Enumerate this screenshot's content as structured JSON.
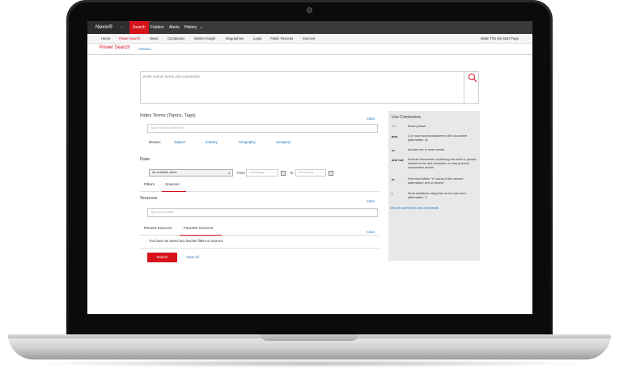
{
  "app": {
    "brand": "Nexis®"
  },
  "top_nav": [
    "Search",
    "Folders",
    "Alerts",
    "History"
  ],
  "sub_nav": [
    "Home",
    "Power Search",
    "News",
    "Companies",
    "Market Insight",
    "Biographies",
    "Legal",
    "Public Records",
    "Sources"
  ],
  "sub_nav_right": "Make This My Start Page",
  "page": {
    "title": "Power Search",
    "actions": "Actions"
  },
  "search": {
    "placeholder": "Enter search terms and connectors"
  },
  "index_terms": {
    "label": "Index Terms (Topics, Tags)",
    "clear": "Clear",
    "placeholder": "Type a word or select term",
    "browse_label": "Browse:",
    "browse_links": [
      "Subject",
      "Industry",
      "Geography",
      "Company"
    ]
  },
  "date": {
    "label": "Date",
    "selected": "All available dates",
    "from_label": "From",
    "to_label": "To",
    "from_placeholder": "mm/dd/yyyy",
    "to_placeholder": "mm/dd/yyyy"
  },
  "filter_tabs": [
    "Filters",
    "Sources"
  ],
  "sources": {
    "label": "Sources",
    "clear": "Clear",
    "placeholder": "Type source name"
  },
  "recent_tabs": [
    "Recent Sources",
    "Favorite Sources"
  ],
  "recent": {
    "clear": "Clear",
    "empty_message": "You have not saved any favorite filters or sources."
  },
  "buttons": {
    "search": "Search",
    "clear_all": "Clear All"
  },
  "connectors": {
    "title": "Use Connectors",
    "items": [
      {
        "op": "\" \"",
        "desc": "Exact phrase"
      },
      {
        "op": "and",
        "desc": "2 or more words anywhere in the document (alternative: &)"
      },
      {
        "op": "or",
        "desc": "Include one or more words"
      },
      {
        "op": "and not",
        "desc": "Exclude documents containing the word or phrase; should be the last connector, or may produce unexpected results"
      },
      {
        "op": "/n",
        "desc": "First word within \"n\" words of the second (alternative: w/n or near/n)"
      },
      {
        "op": "!",
        "desc": "Word variations using this as the root word (alternative: *)"
      }
    ],
    "view_all": "View all connectors and commands"
  }
}
